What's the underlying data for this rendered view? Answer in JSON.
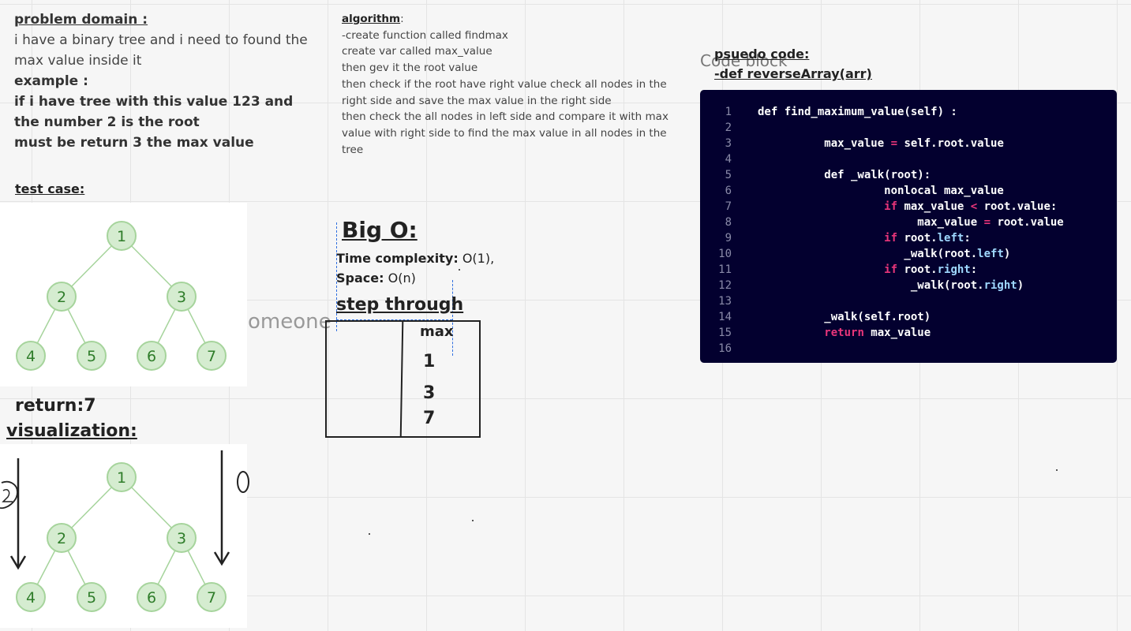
{
  "problem": {
    "title": "problem domain :",
    "text": "i have a binary tree and i need to found the max value inside it",
    "example_label": "example :",
    "example_line1": "if i have tree with this value 123 and the number 2 is the root",
    "example_line2": "must be return 3 the max value"
  },
  "algorithm": {
    "title": "algorithm",
    "lines": [
      "-create function called findmax",
      "create var called max_value",
      "then gev it the root value",
      "then check if the root have right value check all nodes in the right side and save the max value in the right side",
      "then check the all nodes in left side and compare it with max value with right side to find the max value in all nodes in the tree"
    ]
  },
  "test_case": {
    "title": "test case:"
  },
  "tree": {
    "nodes": [
      "1",
      "2",
      "3",
      "4",
      "5",
      "6",
      "7"
    ]
  },
  "big_o": {
    "title": "Big O:",
    "time_label": "Time complexity:",
    "time_value": "O(1),",
    "space_label": "Space:",
    "space_value": "O(n)"
  },
  "step_through": {
    "title": "step through",
    "header": "max",
    "values": [
      "1",
      "3",
      "7"
    ]
  },
  "overlay_text": "omeone",
  "pseudo": {
    "title": "psuedo code:",
    "subtitle": "-def reverseArray(arr)",
    "code_block_label": "Code block"
  },
  "code": {
    "line_numbers": [
      "1",
      "2",
      "3",
      "4",
      "5",
      "6",
      "7",
      "8",
      "9",
      "10",
      "11",
      "12",
      "13",
      "14",
      "15",
      "16"
    ],
    "lines": [
      "def find_maximum_value(self) :",
      "",
      "          max_value = self.root.value",
      "",
      "          def _walk(root):",
      "                   nonlocal max_value",
      "                   if max_value < root.value:",
      "                        max_value = root.value",
      "                   if root.left:",
      "                      _walk(root.left)",
      "                   if root.right:",
      "                       _walk(root.right)",
      "",
      "          _walk(self.root)",
      "          return max_value",
      ""
    ],
    "colors": {
      "background": "#03002f",
      "keyword": "#e8357a",
      "attribute": "#9fd8ff"
    }
  },
  "return_text": "return:7",
  "visualization": {
    "title": "visualization:",
    "left_mark": "2",
    "right_mark": "0"
  },
  "colors": {
    "node_fill": "#d5ecd0",
    "node_stroke": "#a6d49c",
    "node_text": "#2f7d2a",
    "edge": "#a6d49c"
  }
}
